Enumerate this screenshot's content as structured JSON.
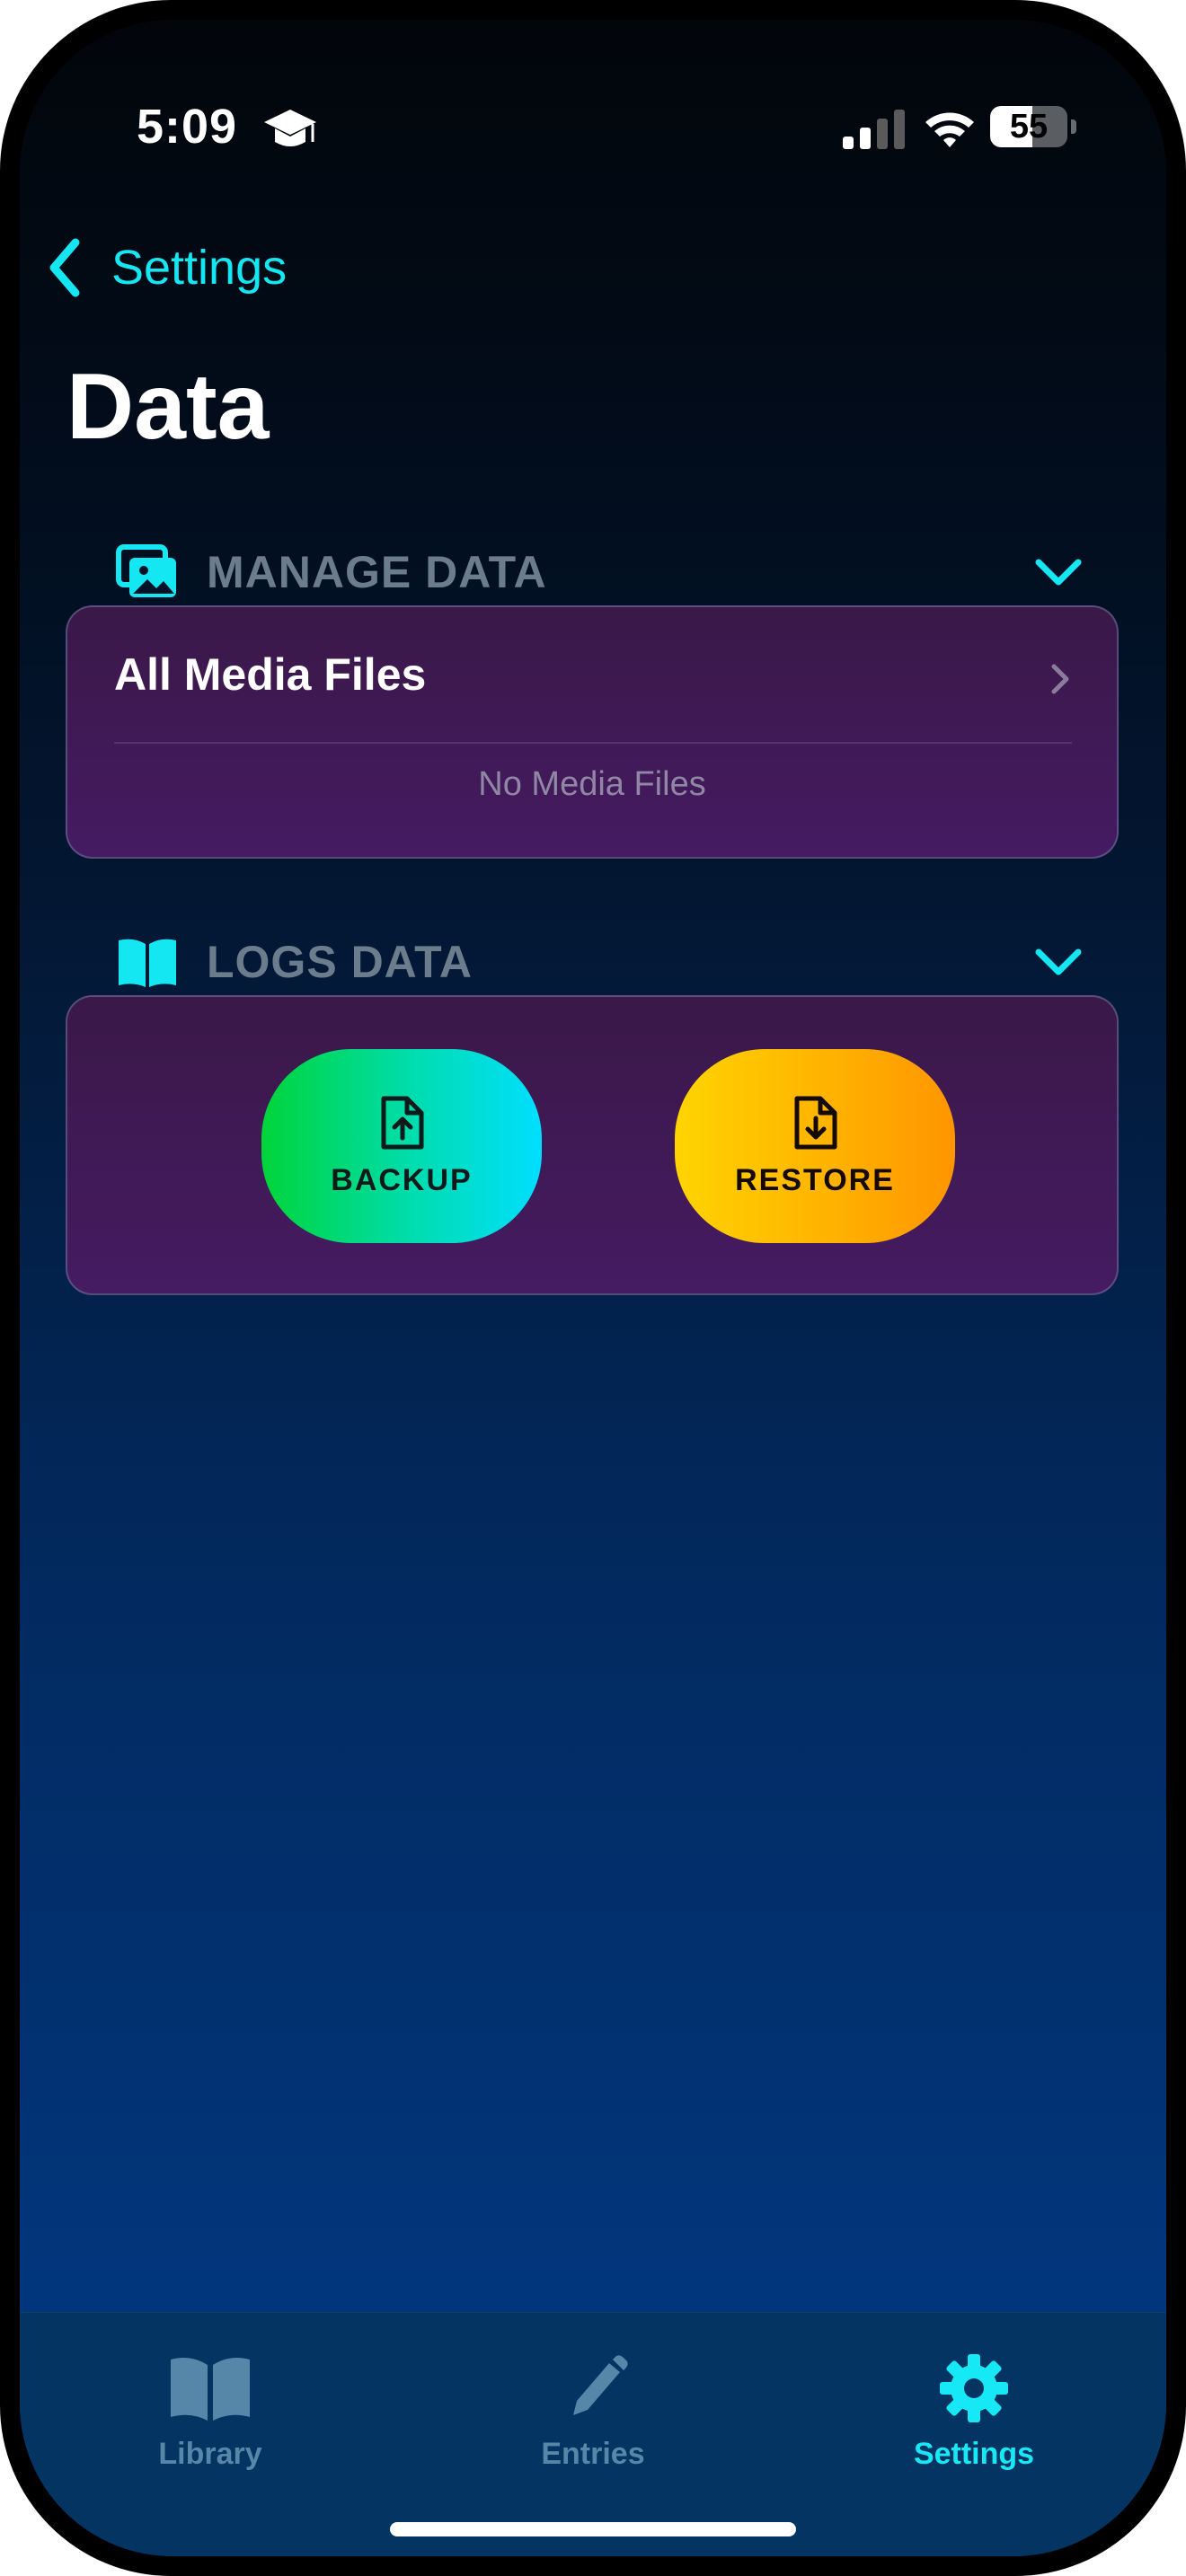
{
  "status_bar": {
    "time": "5:09",
    "battery": "55",
    "battery_level": 0.55
  },
  "nav": {
    "back_label": "Settings",
    "title": "Data"
  },
  "sections": {
    "manage": {
      "title": "MANAGE DATA",
      "row_label": "All Media Files",
      "empty_text": "No Media Files"
    },
    "logs": {
      "title": "LOGS DATA",
      "backup_label": "BACKUP",
      "restore_label": "RESTORE"
    }
  },
  "tab_bar": {
    "items": [
      {
        "label": "Library",
        "icon": "book-icon",
        "active": false
      },
      {
        "label": "Entries",
        "icon": "pencil-icon",
        "active": false
      },
      {
        "label": "Settings",
        "icon": "gear-icon",
        "active": true
      }
    ]
  },
  "colors": {
    "accent": "#14e6f2",
    "backup_gradient": [
      "#00d43a",
      "#00deff"
    ],
    "restore_gradient": [
      "#ffd400",
      "#ff9500"
    ],
    "card_background": "#451b62"
  }
}
